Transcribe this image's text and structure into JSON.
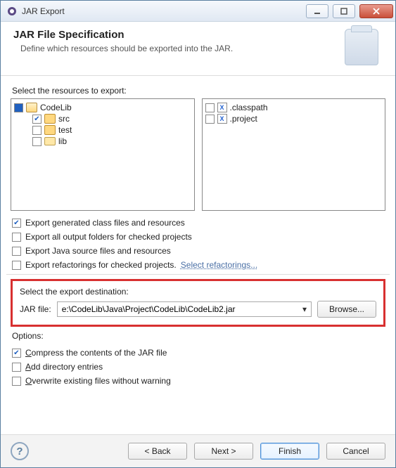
{
  "window": {
    "title": "JAR Export"
  },
  "header": {
    "title": "JAR File Specification",
    "description": "Define which resources should be exported into the JAR."
  },
  "resources": {
    "label": "Select the resources to export:",
    "left": [
      {
        "label": "CodeLib",
        "checked": "mixed",
        "type": "project"
      },
      {
        "label": "src",
        "checked": true,
        "type": "package",
        "child": true
      },
      {
        "label": "test",
        "checked": false,
        "type": "package",
        "child": true
      },
      {
        "label": "lib",
        "checked": false,
        "type": "folder",
        "child": true
      }
    ],
    "right": [
      {
        "label": ".classpath",
        "checked": false,
        "type": "xfile"
      },
      {
        "label": ".project",
        "checked": false,
        "type": "xfile"
      }
    ]
  },
  "export_options": [
    {
      "label": "Export generated class files and resources",
      "checked": true
    },
    {
      "label": "Export all output folders for checked projects",
      "checked": false
    },
    {
      "label": "Export Java source files and resources",
      "checked": false
    },
    {
      "label": "Export refactorings for checked projects.",
      "checked": false,
      "trailing_link": "Select refactorings..."
    }
  ],
  "destination": {
    "group_label": "Select the export destination:",
    "field_label": "JAR file:",
    "value": "e:\\CodeLib\\Java\\Project\\CodeLib\\CodeLib2.jar",
    "browse_label": "Browse..."
  },
  "options_group": {
    "label": "Options:",
    "items": [
      {
        "label": "Compress the contents of the JAR file",
        "checked": true,
        "accel_index": 0
      },
      {
        "label": "Add directory entries",
        "checked": false,
        "accel_index": 0
      },
      {
        "label": "Overwrite existing files without warning",
        "checked": false,
        "accel_index": 0
      }
    ]
  },
  "buttons": {
    "back": "< Back",
    "next": "Next >",
    "finish": "Finish",
    "cancel": "Cancel"
  }
}
